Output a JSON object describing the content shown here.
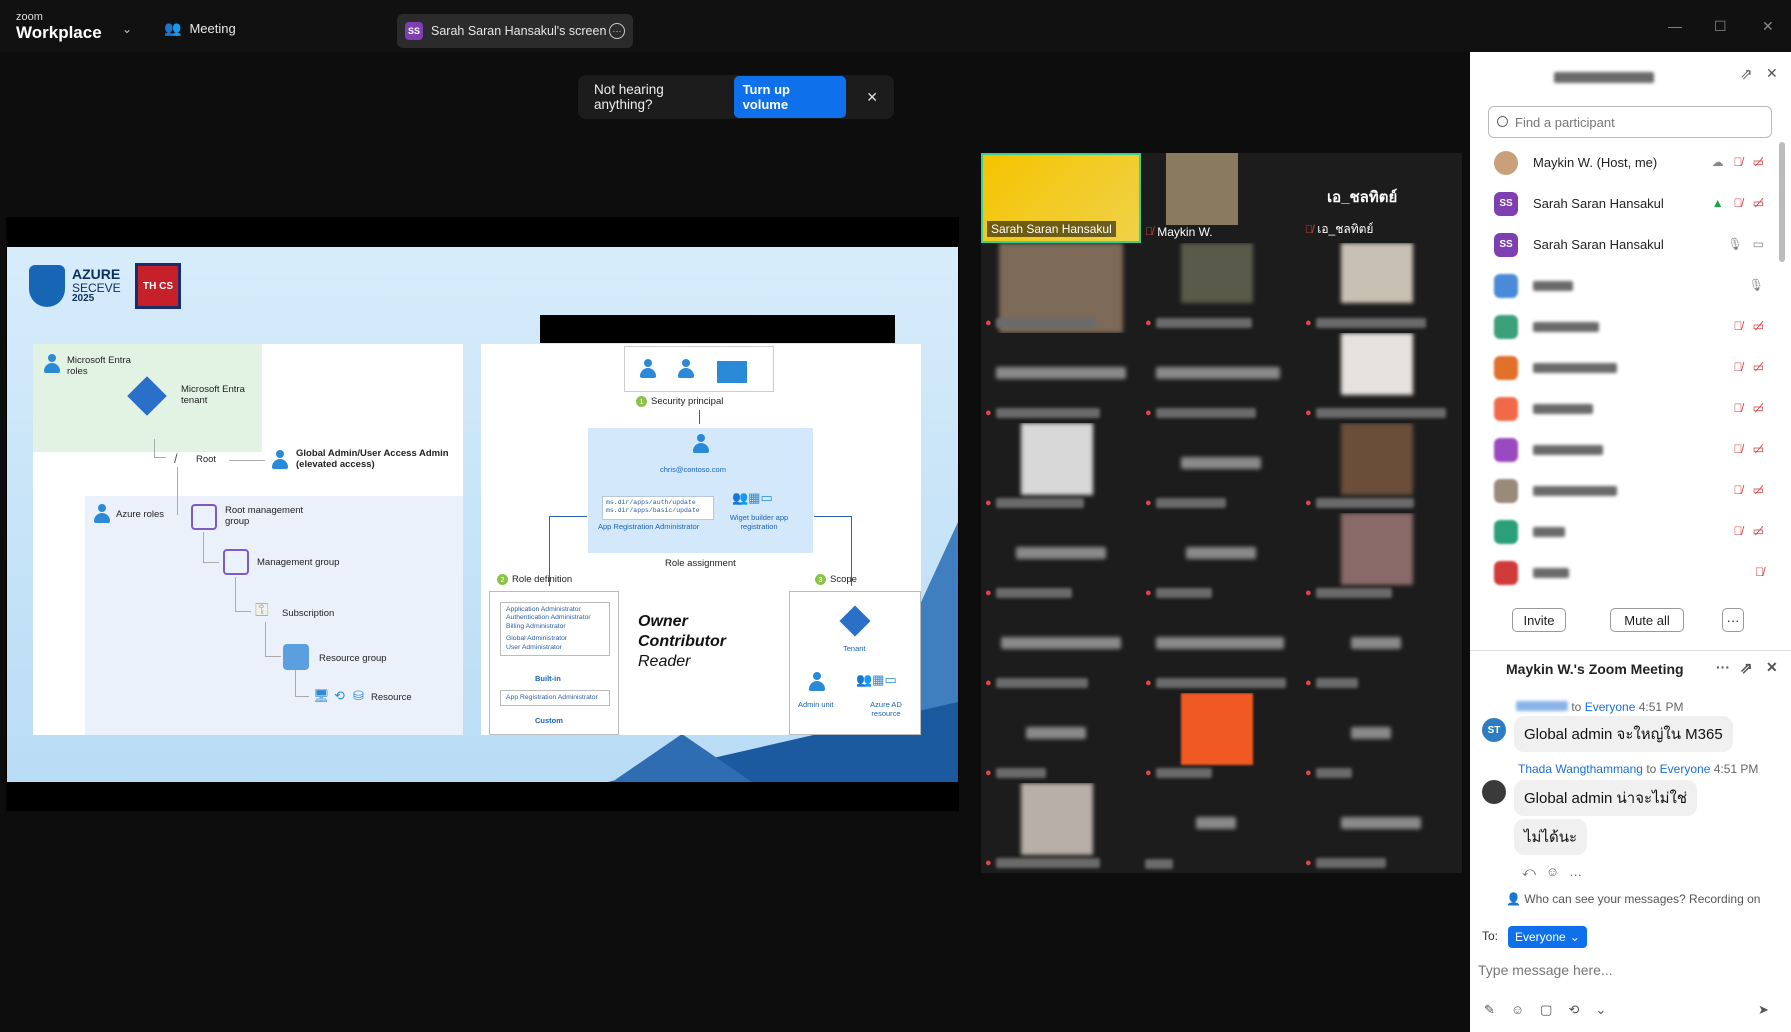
{
  "topbar": {
    "brand_small": "zoom",
    "brand_big": "Workplace",
    "meeting_label": "Meeting",
    "screen_badge": "SS",
    "screen_label": "Sarah Saran Hansakul's screen"
  },
  "toast": {
    "message": "Not hearing anything?",
    "button": "Turn up volume",
    "close": "✕"
  },
  "slide": {
    "logo_line1": "AZURE",
    "logo_line2": "SECEVE",
    "logo_line3": "2025",
    "thcs": "TH CS",
    "left": {
      "entra_roles": "Microsoft Entra roles",
      "entra_tenant": "Microsoft Entra tenant",
      "root": "Root",
      "global_admin": "Global Admin/User Access Admin",
      "elevated": "(elevated access)",
      "azure_roles": "Azure roles",
      "root_mg": "Root management group",
      "mg": "Management group",
      "subscription": "Subscription",
      "rg": "Resource group",
      "resource": "Resource"
    },
    "right": {
      "security_principal": "Security principal",
      "email": "chris@contoso.com",
      "code1": "ms.dir/apps/auth/update",
      "code2": "ms.dir/apps/basic/update",
      "app_reg_admin": "App Registration Administrator",
      "widget": "Wiget builder app registration",
      "role_assignment": "Role assignment",
      "role_definition": "Role definition",
      "scope": "Scope",
      "builtin_roles": [
        "Application Administrator",
        "Authentication Administrator",
        "Billing Administrator",
        "Global Administrator",
        "User Administrator"
      ],
      "builtin": "Built-in",
      "custom_role": "App Registration Administrator",
      "custom": "Custom",
      "owner": "Owner",
      "contributor": "Contributor",
      "reader": "Reader",
      "tenant": "Tenant",
      "admin_unit": "Admin unit",
      "azure_ad": "Azure AD resource"
    }
  },
  "gallery": {
    "tile1_name": "Sarah Saran Hansakul",
    "tile2_name": "Maykin W.",
    "tile3_title": "เอ_ชลทิตย์",
    "tile3_name": "เอ_ชลทิตย์"
  },
  "participants": {
    "search_placeholder": "Find a participant",
    "rows": [
      {
        "name": "Maykin W. (Host, me)",
        "badge": "",
        "color": "#c9a07a"
      },
      {
        "name": "Sarah Saran Hansakul",
        "badge": "SS",
        "color": "#7e3fb0"
      },
      {
        "name": "Sarah Saran Hansakul",
        "badge": "SS",
        "color": "#7e3fb0"
      }
    ],
    "invite": "Invite",
    "mute_all": "Mute all",
    "more": "···"
  },
  "chat": {
    "title": "Maykin W.'s Zoom Meeting",
    "msg1": {
      "to": "to",
      "to_who": "Everyone",
      "time": "4:51 PM",
      "avatar": "ST",
      "text": "Global admin จะใหญ่ใน M365"
    },
    "msg2": {
      "sender": "Thada Wangthammang",
      "to": "to",
      "to_who": "Everyone",
      "time": "4:51 PM",
      "text1": "Global admin น่าจะไม่ใช่",
      "text2": "ไม่ได้นะ"
    },
    "privacy": "Who can see your messages? Recording on",
    "to_label": "To:",
    "to_value": "Everyone",
    "input_placeholder": "Type message here..."
  },
  "colors": {
    "accent": "#0e71eb",
    "muted_red": "#d43a3a"
  }
}
